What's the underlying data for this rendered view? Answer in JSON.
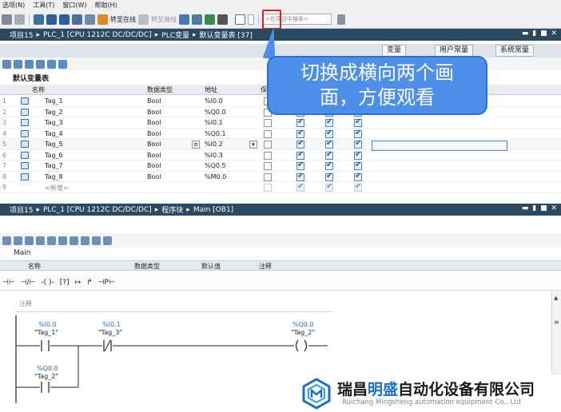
{
  "menubar": {
    "items": [
      "选项(N)",
      "工具(T)",
      "窗口(W)",
      "帮助(H)"
    ]
  },
  "toolbar": {
    "go_online": "转至在线",
    "go_offline": "转至离线",
    "search_placeholder": "<在项目中搜索>"
  },
  "editor_top": {
    "breadcrumb": [
      "项目15",
      "PLC_1 [CPU 1212C DC/DC/DC]",
      "PLC变量",
      "默认变量表 [37]"
    ],
    "window_controls": "▬ ▮ ■ ✕"
  },
  "tabs": [
    "变量",
    "用户常量",
    "系统常量"
  ],
  "tag_table": {
    "caption": "默认变量表",
    "columns": [
      "名称",
      "数据类型",
      "地址",
      "保"
    ],
    "rows": [
      {
        "num": "1",
        "name": "Tag_1",
        "type": "Bool",
        "address": "%I0.0"
      },
      {
        "num": "2",
        "name": "Tag_2",
        "type": "Bool",
        "address": "%Q0.0"
      },
      {
        "num": "3",
        "name": "Tag_3",
        "type": "Bool",
        "address": "%I0.1"
      },
      {
        "num": "4",
        "name": "Tag_4",
        "type": "Bool",
        "address": "%Q0.1"
      },
      {
        "num": "5",
        "name": "Tag_5",
        "type": "Bool",
        "address": "%I0.2"
      },
      {
        "num": "6",
        "name": "Tag_6",
        "type": "Bool",
        "address": "%I0.3"
      },
      {
        "num": "7",
        "name": "Tag_7",
        "type": "Bool",
        "address": "%Q0.5"
      },
      {
        "num": "8",
        "name": "Tag_8",
        "type": "Bool",
        "address": "%M0.0"
      },
      {
        "num": "9",
        "name": "<新增>",
        "type": "",
        "address": ""
      }
    ]
  },
  "callout": {
    "line1": "切换成横向两个画",
    "line2": "面，方便观看"
  },
  "editor_bottom": {
    "breadcrumb": [
      "项目15",
      "PLC_1 [CPU 1212C DC/DC/DC]",
      "程序块",
      "Main [OB1]"
    ],
    "window_controls": "▬ ▮ ■ ✕"
  },
  "block": {
    "name": "Main",
    "columns": [
      "名称",
      "数据类型",
      "默认值",
      "注释"
    ],
    "comment_label": "注释"
  },
  "ladder": {
    "contact1": {
      "address": "%I0.0",
      "tag": "\"Tag_1\""
    },
    "contact2": {
      "address": "%I0.1",
      "tag": "\"Tag_3\""
    },
    "coil": {
      "address": "%Q0.0",
      "tag": "\"Tag_2\""
    },
    "branch": {
      "address": "%Q0.0",
      "tag": "\"Tag_2\""
    }
  },
  "watermark": {
    "cn_1": "瑞昌",
    "cn_2": "明盛",
    "cn_3": "自动化设备有限公司",
    "en": "Ruichang Mingsheng automation equipment Co., Ltd"
  },
  "colors": {
    "title_bar": "#2b4960",
    "callout": "#4d8ee8",
    "highlight": "#e02020",
    "brand_blue": "#1a6fc8"
  }
}
